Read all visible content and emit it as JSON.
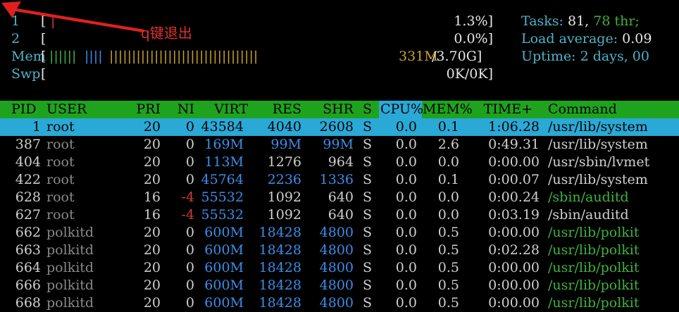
{
  "meters": {
    "cpu1": {
      "label": "1",
      "open": "[",
      "bar": "|",
      "value": "1.3%]"
    },
    "cpu2": {
      "label": "2",
      "open": "[",
      "value": "0.0%]"
    },
    "mem": {
      "label": "Mem",
      "open": "[",
      "bars_green": "||||||",
      "bars_blue": "||||",
      "bars_yellow": "|||||||||||||||||||||||||||||||||",
      "value": "331M",
      "total": "/3.70G]"
    },
    "swp": {
      "label": "Swp",
      "open": "[",
      "value": "0K/0K]"
    }
  },
  "summary": {
    "tasks_label": "Tasks: ",
    "tasks_count": "81, ",
    "thr": "78 thr;",
    "load_label": "Load average: ",
    "load_value": "0.09",
    "uptime_label": "Uptime: ",
    "uptime_value": "2 days, 00"
  },
  "annotation": "q键退出",
  "columns": [
    "PID",
    "USER",
    "PRI",
    "NI",
    "VIRT",
    "RES",
    "SHR",
    "S",
    "CPU%",
    "MEM%",
    "TIME+",
    "Command"
  ],
  "processes": [
    {
      "pid": "1",
      "user": "root",
      "pri": "20",
      "ni": "0",
      "virt": "43584",
      "res": "4040",
      "shr": "2608",
      "s": "S",
      "cpu": "0.0",
      "mem": "0.1",
      "time": "1:06.28",
      "cmd": "/usr/lib/system"
    },
    {
      "pid": "387",
      "user": "root",
      "pri": "20",
      "ni": "0",
      "virt": "169M",
      "res": "99M",
      "shr": "99M",
      "s": "S",
      "cpu": "0.0",
      "mem": "2.6",
      "time": "0:49.31",
      "cmd": "/usr/lib/system"
    },
    {
      "pid": "404",
      "user": "root",
      "pri": "20",
      "ni": "0",
      "virt": "113M",
      "res": "1276",
      "shr": "964",
      "s": "S",
      "cpu": "0.0",
      "mem": "0.0",
      "time": "0:00.00",
      "cmd": "/usr/sbin/lvmet"
    },
    {
      "pid": "422",
      "user": "root",
      "pri": "20",
      "ni": "0",
      "virt": "45764",
      "res": "2236",
      "shr": "1336",
      "s": "S",
      "cpu": "0.0",
      "mem": "0.1",
      "time": "0:00.07",
      "cmd": "/usr/lib/system"
    },
    {
      "pid": "628",
      "user": "root",
      "pri": "16",
      "ni": "-4",
      "virt": "55532",
      "res": "1092",
      "shr": "640",
      "s": "S",
      "cpu": "0.0",
      "mem": "0.0",
      "time": "0:00.24",
      "cmd": "/sbin/auditd"
    },
    {
      "pid": "627",
      "user": "root",
      "pri": "16",
      "ni": "-4",
      "virt": "55532",
      "res": "1092",
      "shr": "640",
      "s": "S",
      "cpu": "0.0",
      "mem": "0.0",
      "time": "0:03.19",
      "cmd": "/sbin/auditd"
    },
    {
      "pid": "662",
      "user": "polkitd",
      "pri": "20",
      "ni": "0",
      "virt": "600M",
      "res": "18428",
      "shr": "4800",
      "s": "S",
      "cpu": "0.0",
      "mem": "0.5",
      "time": "0:00.00",
      "cmd": "/usr/lib/polkit"
    },
    {
      "pid": "663",
      "user": "polkitd",
      "pri": "20",
      "ni": "0",
      "virt": "600M",
      "res": "18428",
      "shr": "4800",
      "s": "S",
      "cpu": "0.0",
      "mem": "0.5",
      "time": "0:02.28",
      "cmd": "/usr/lib/polkit"
    },
    {
      "pid": "664",
      "user": "polkitd",
      "pri": "20",
      "ni": "0",
      "virt": "600M",
      "res": "18428",
      "shr": "4800",
      "s": "S",
      "cpu": "0.0",
      "mem": "0.5",
      "time": "0:00.00",
      "cmd": "/usr/lib/polkit"
    },
    {
      "pid": "666",
      "user": "polkitd",
      "pri": "20",
      "ni": "0",
      "virt": "600M",
      "res": "18428",
      "shr": "4800",
      "s": "S",
      "cpu": "0.0",
      "mem": "0.5",
      "time": "0:00.00",
      "cmd": "/usr/lib/polkit"
    },
    {
      "pid": "668",
      "user": "polkitd",
      "pri": "20",
      "ni": "0",
      "virt": "600M",
      "res": "18428",
      "shr": "4800",
      "s": "S",
      "cpu": "0.0",
      "mem": "0.5",
      "time": "0:00.00",
      "cmd": "/usr/lib/polkit"
    }
  ]
}
